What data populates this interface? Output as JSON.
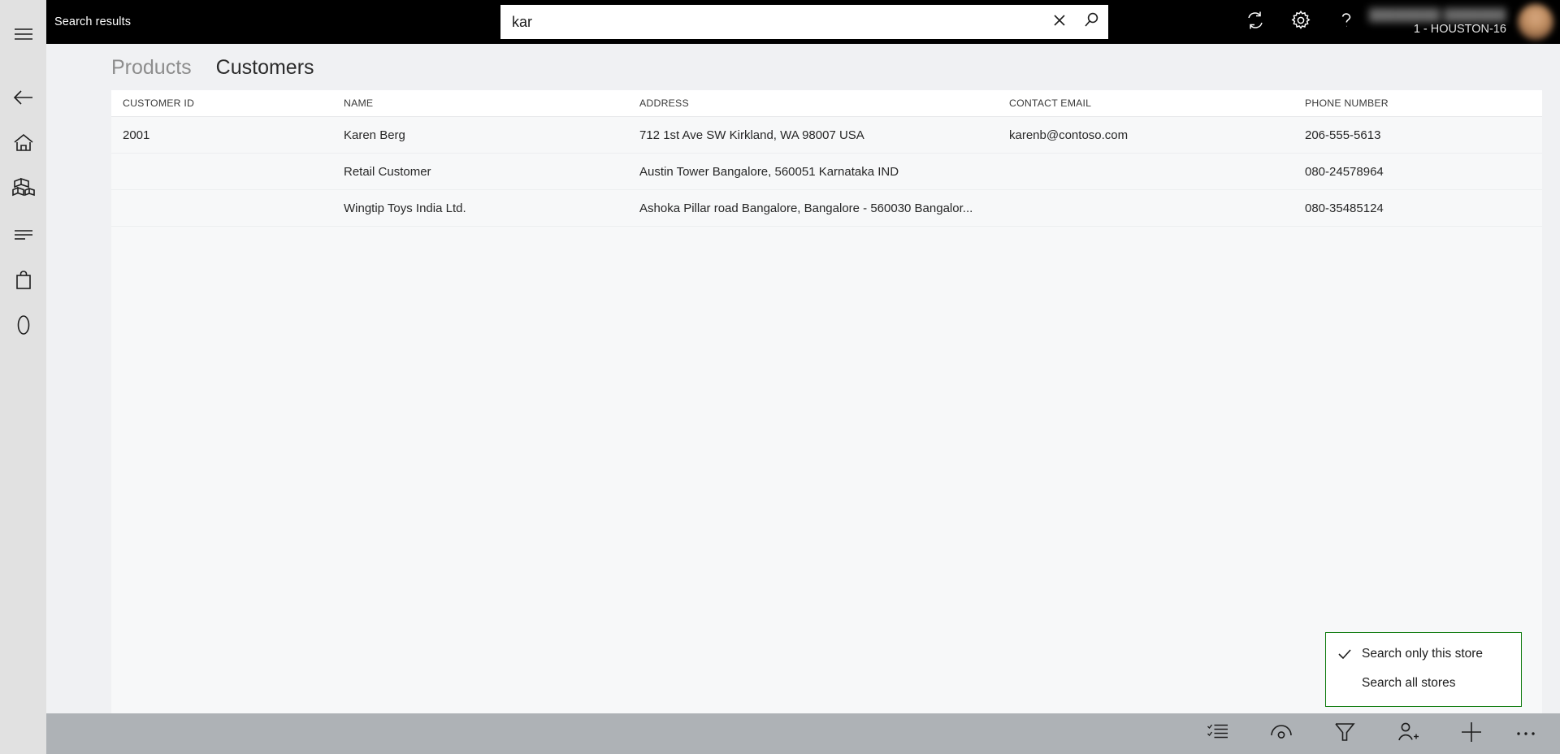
{
  "window": {
    "topbar_title": "Search results",
    "accent_green": "#107c10",
    "topbar_bg": "#000000",
    "footer_bg": "#aeb2b6"
  },
  "sidebar": {
    "items": [
      {
        "name": "hamburger-menu",
        "label": "Menu",
        "icon": "hamburger-icon"
      },
      {
        "name": "back",
        "label": "Back",
        "icon": "arrow-left-icon"
      },
      {
        "name": "home",
        "label": "Home",
        "icon": "home-icon"
      },
      {
        "name": "products",
        "label": "Products",
        "icon": "boxes-icon"
      },
      {
        "name": "transactions",
        "label": "Transactions",
        "icon": "lines-icon"
      },
      {
        "name": "shop",
        "label": "Shop",
        "icon": "shopping-bag-icon"
      },
      {
        "name": "cash",
        "label": "Cash management",
        "icon": "oval-icon"
      }
    ]
  },
  "search": {
    "value": "kar",
    "placeholder": "Search",
    "clear_icon": "close-icon",
    "submit_icon": "search-icon"
  },
  "topbar_actions": {
    "sync_icon": "refresh-icon",
    "settings_icon": "gear-icon",
    "help_icon": "question-mark-icon",
    "username": "████████ ███████",
    "store_id": "1 - HOUSTON-16",
    "avatar_name": "avatar"
  },
  "tabs": [
    {
      "label": "Products",
      "active": false
    },
    {
      "label": "Customers",
      "active": true
    }
  ],
  "table": {
    "columns": [
      "CUSTOMER ID",
      "NAME",
      "ADDRESS",
      "CONTACT EMAIL",
      "PHONE NUMBER"
    ],
    "rows": [
      {
        "customer_id": "2001",
        "name": "Karen Berg",
        "address": "712 1st Ave SW Kirkland, WA 98007 USA",
        "contact_email": "karenb@contoso.com",
        "phone_number": "206-555-5613"
      },
      {
        "customer_id": "",
        "name": "Retail Customer",
        "address": "Austin Tower Bangalore, 560051 Karnataka IND",
        "contact_email": "",
        "phone_number": "080-24578964"
      },
      {
        "customer_id": "",
        "name": "Wingtip Toys India Ltd.",
        "address": "Ashoka Pillar road Bangalore, Bangalore - 560030 Bangalor...",
        "contact_email": "",
        "phone_number": "080-35485124"
      }
    ]
  },
  "popup": {
    "items": [
      {
        "label": "Search only this store",
        "checked": true
      },
      {
        "label": "Search all stores",
        "checked": false
      }
    ]
  },
  "footer_actions": [
    {
      "name": "select-mode",
      "label": "Select",
      "icon": "checklist-icon"
    },
    {
      "name": "view-details",
      "label": "View details",
      "icon": "eye-icon"
    },
    {
      "name": "filter",
      "label": "Filter",
      "icon": "funnel-icon"
    },
    {
      "name": "add-customer",
      "label": "Add customer",
      "icon": "person-add-icon"
    },
    {
      "name": "new",
      "label": "New",
      "icon": "plus-icon"
    },
    {
      "name": "more",
      "label": "More",
      "icon": "ellipsis-icon"
    }
  ]
}
